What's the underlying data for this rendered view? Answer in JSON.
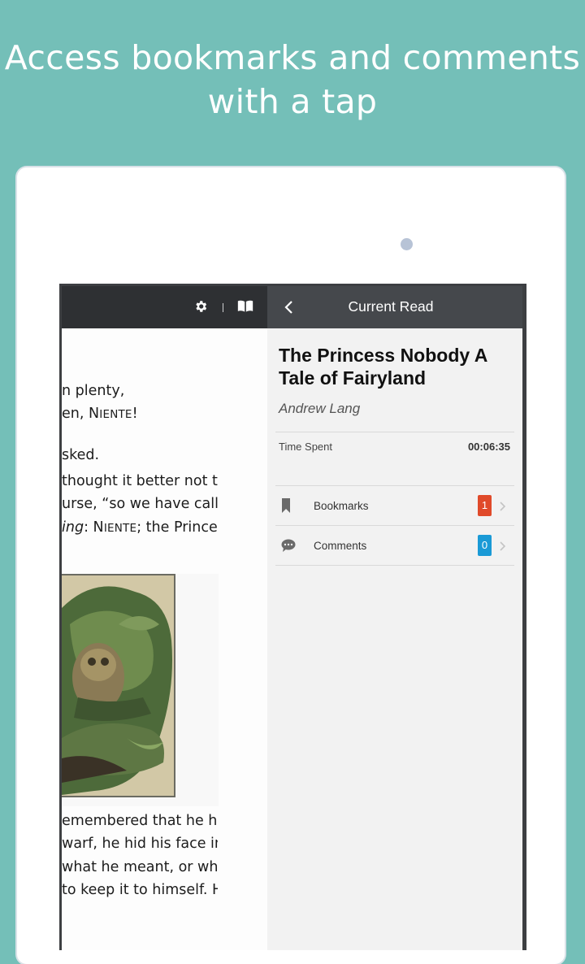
{
  "headline": {
    "line1": "Access bookmarks and comments",
    "line2": "with a tap"
  },
  "reader": {
    "toolbar_icons": [
      "gear-icon",
      "book-open-icon"
    ],
    "lines": [
      {
        "pre": "n plenty,",
        "sc": "",
        "post": "",
        "italic": ""
      },
      {
        "pre": "en, ",
        "sc": "NIENTE",
        "post": "!",
        "italic": ""
      },
      {
        "pre": "sked.",
        "sc": "",
        "post": "",
        "italic": ""
      },
      {
        "pre": "thought it better not to",
        "sc": "",
        "post": "",
        "italic": ""
      },
      {
        "pre": "urse, “so we have called",
        "sc": "",
        "post": "",
        "italic": ""
      },
      {
        "pre": ": ",
        "sc": "NIENTE",
        "post": "; the Princess",
        "italic": "ing"
      },
      {
        "pre": "emembered that he had",
        "sc": "",
        "post": "",
        "italic": ""
      },
      {
        "pre": "warf, he hid his face in his",
        "sc": "",
        "post": "",
        "italic": ""
      },
      {
        "pre": " what he meant, or why",
        "sc": "",
        "post": "",
        "italic": ""
      },
      {
        "pre": "to keep it to himself. He",
        "sc": "",
        "post": "",
        "italic": ""
      }
    ],
    "illustration": "owl-in-foliage-illustration"
  },
  "panel": {
    "title": "Current Read",
    "back_icon": "chevron-left-icon",
    "book_title": "The Princess Nobody A Tale of Fairyland",
    "author": "Andrew Lang",
    "time_spent_label": "Time Spent",
    "time_spent_value": "00:06:35",
    "rows": [
      {
        "label": "Bookmarks",
        "count": "1",
        "color": "#e04a2a",
        "icon": "bookmark-icon"
      },
      {
        "label": "Comments",
        "count": "0",
        "color": "#1a9ad6",
        "icon": "comment-icon"
      }
    ]
  },
  "colors": {
    "background": "#74bfb8",
    "toolbar": "#2e3033",
    "panel_header": "#45484c"
  }
}
